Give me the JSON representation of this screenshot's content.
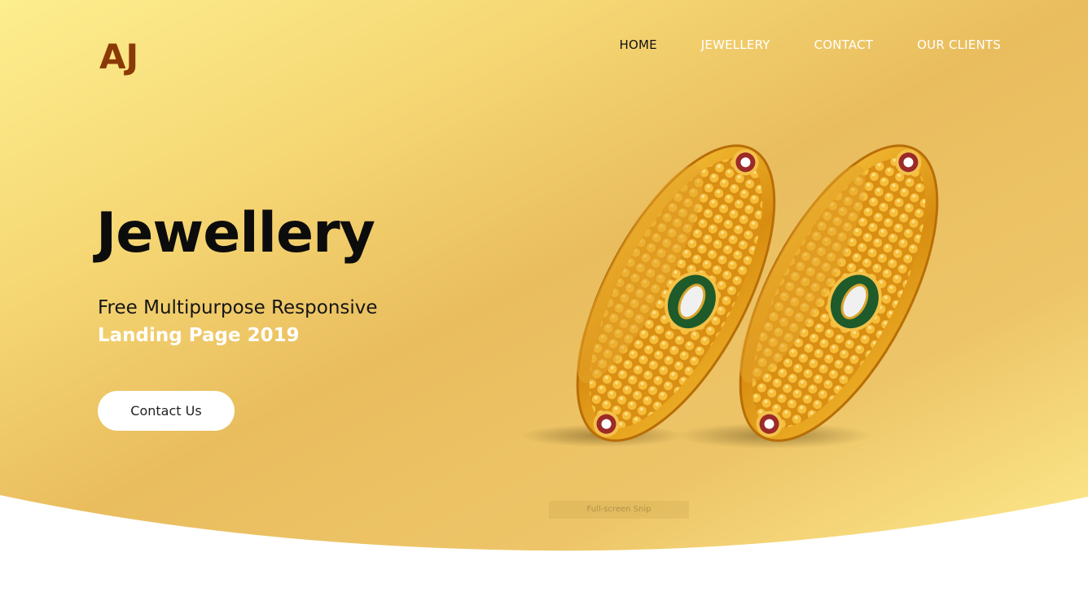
{
  "brand": {
    "logo_text": "AJ",
    "logo_color": "#8a3a06"
  },
  "nav": {
    "items": [
      {
        "label": "HOME",
        "active": true
      },
      {
        "label": "JEWELLERY",
        "active": false
      },
      {
        "label": "CONTACT",
        "active": false
      },
      {
        "label": "OUR CLIENTS",
        "active": false
      }
    ]
  },
  "hero": {
    "title": "Jewellery",
    "subtitle": "Free Multipurpose Responsive",
    "subtitle_strong": "Landing Page 2019",
    "cta_label": "Contact Us",
    "image_icon": "gold-bangles-image"
  },
  "overlay": {
    "snip_label": "Full-screen Snip"
  },
  "colors": {
    "gradient_light": "#fde98a",
    "gradient_mid": "#edc766",
    "gradient_dark": "#e8b85a",
    "gold": "#e0a326",
    "text_dark": "#0c0c0c",
    "white": "#ffffff"
  }
}
